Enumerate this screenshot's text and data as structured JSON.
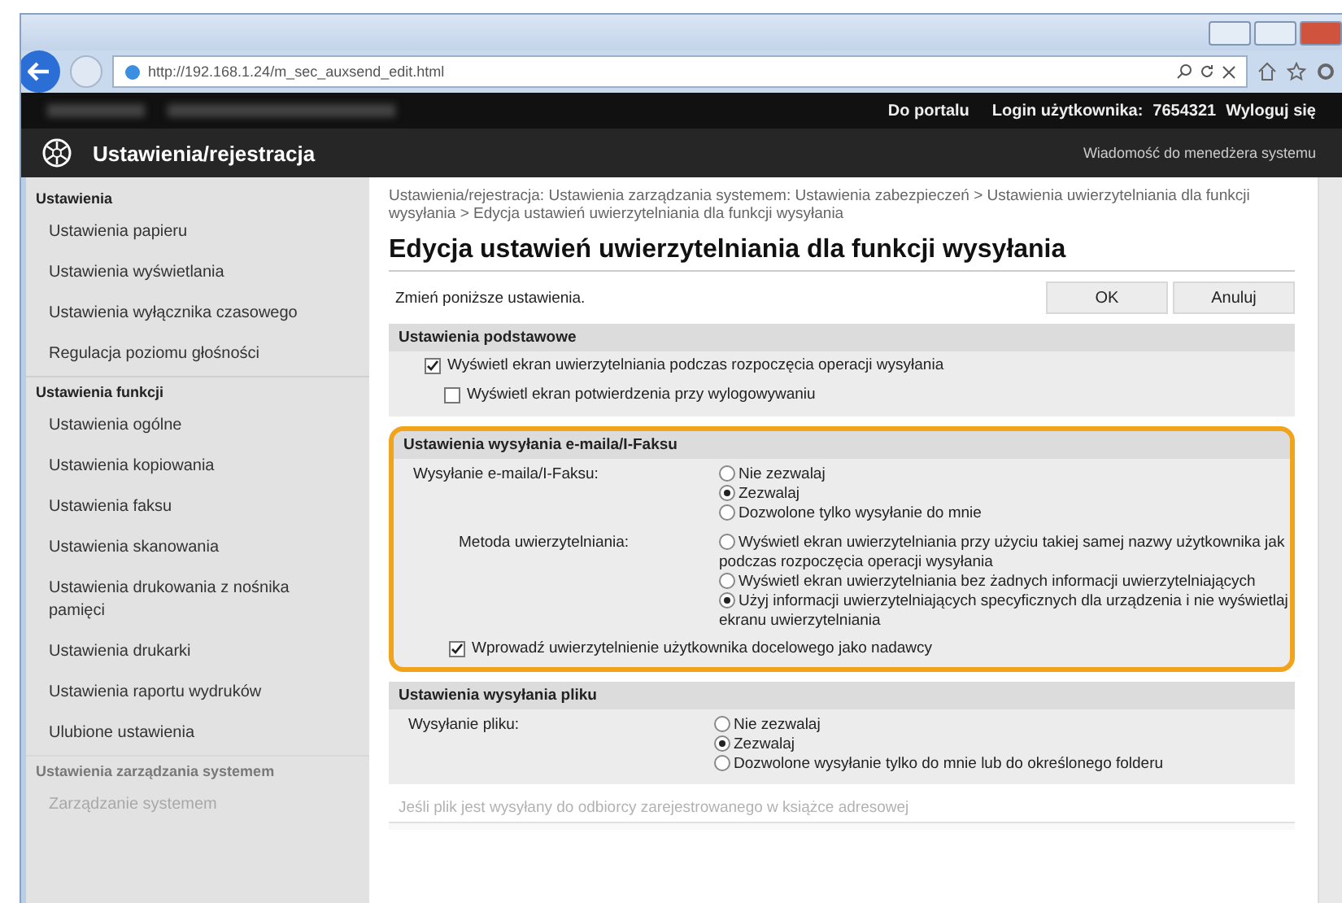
{
  "browser": {
    "url": "http://192.168.1.24/m_sec_auxsend_edit.html"
  },
  "top_bar": {
    "portal_link": "Do portalu",
    "login_label": "Login użytkownika:",
    "login_value": "7654321",
    "logout_link": "Wyloguj się"
  },
  "header": {
    "title": "Ustawienia/rejestracja",
    "message_link": "Wiadomość do menedżera systemu"
  },
  "sidebar": {
    "sections": [
      {
        "title": "Ustawienia",
        "items": [
          "Ustawienia papieru",
          "Ustawienia wyświetlania",
          "Ustawienia wyłącznika czasowego",
          "Regulacja poziomu głośności"
        ]
      },
      {
        "title": "Ustawienia funkcji",
        "items": [
          "Ustawienia ogólne",
          "Ustawienia kopiowania",
          "Ustawienia faksu",
          "Ustawienia skanowania",
          "Ustawienia drukowania z nośnika pamięci",
          "Ustawienia drukarki",
          "Ustawienia raportu wydruków",
          "Ulubione ustawienia"
        ]
      },
      {
        "title": "Ustawienia zarządzania systemem",
        "items": [
          "Zarządzanie systemem"
        ]
      }
    ]
  },
  "breadcrumb": "Ustawienia/rejestracja: Ustawienia zarządzania systemem: Ustawienia zabezpieczeń > Ustawienia uwierzytelniania dla funkcji wysyłania > Edycja ustawień uwierzytelniania dla funkcji wysyłania",
  "heading": "Edycja ustawień uwierzytelniania dla funkcji wysyłania",
  "instruction": "Zmień poniższe ustawienia.",
  "buttons": [
    "OK",
    "Anuluj"
  ],
  "sections": [
    {
      "title": "Ustawienia podstawowe",
      "highlighted": false,
      "disabled": false,
      "rows": [
        {
          "kind": "checkbox",
          "label": "Wyświetl ekran uwierzytelniania podczas rozpoczęcia operacji wysyłania",
          "checked": true,
          "children": [
            {
              "kind": "checkbox",
              "label": "Wyświetl ekran potwierdzenia przy wylogowywaniu",
              "checked": false
            }
          ]
        }
      ]
    },
    {
      "title": "Ustawienia wysyłania e-maila/I-Faksu",
      "highlighted": true,
      "disabled": false,
      "rows": [
        {
          "kind": "radio_group",
          "label": "Wysyłanie e-maila/I-Faksu:",
          "options": [
            {
              "label": "Nie zezwalaj",
              "selected": false
            },
            {
              "label": "Zezwalaj",
              "selected": true
            },
            {
              "label": "Dozwolone tylko wysyłanie do mnie",
              "selected": false
            }
          ],
          "children": [
            {
              "kind": "radio_group",
              "label": "Metoda uwierzytelniania:",
              "options": [
                {
                  "label": "Wyświetl ekran uwierzytelniania przy użyciu takiej samej nazwy użytkownika jak podczas rozpoczęcia operacji wysyłania",
                  "selected": false
                },
                {
                  "label": "Wyświetl ekran uwierzytelniania bez żadnych informacji uwierzytelniających",
                  "selected": false
                },
                {
                  "label": "Użyj informacji uwierzytelniających specyficznych dla urządzenia i nie wyświetlaj ekranu uwierzytelniania",
                  "selected": true
                }
              ]
            },
            {
              "kind": "checkbox",
              "label": "Wprowadź uwierzytelnienie użytkownika docelowego jako nadawcy",
              "checked": true
            }
          ]
        }
      ]
    },
    {
      "title": "Ustawienia wysyłania pliku",
      "highlighted": false,
      "disabled": false,
      "rows": [
        {
          "kind": "radio_group",
          "label": "Wysyłanie pliku:",
          "options": [
            {
              "label": "Nie zezwalaj",
              "selected": false
            },
            {
              "label": "Zezwalaj",
              "selected": true
            },
            {
              "label": "Dozwolone wysyłanie tylko do mnie lub do określonego folderu",
              "selected": false
            }
          ]
        }
      ]
    },
    {
      "title": "Jeśli plik jest wysyłany do odbiorcy zarejestrowanego w książce adresowej",
      "highlighted": false,
      "disabled": true
    }
  ]
}
